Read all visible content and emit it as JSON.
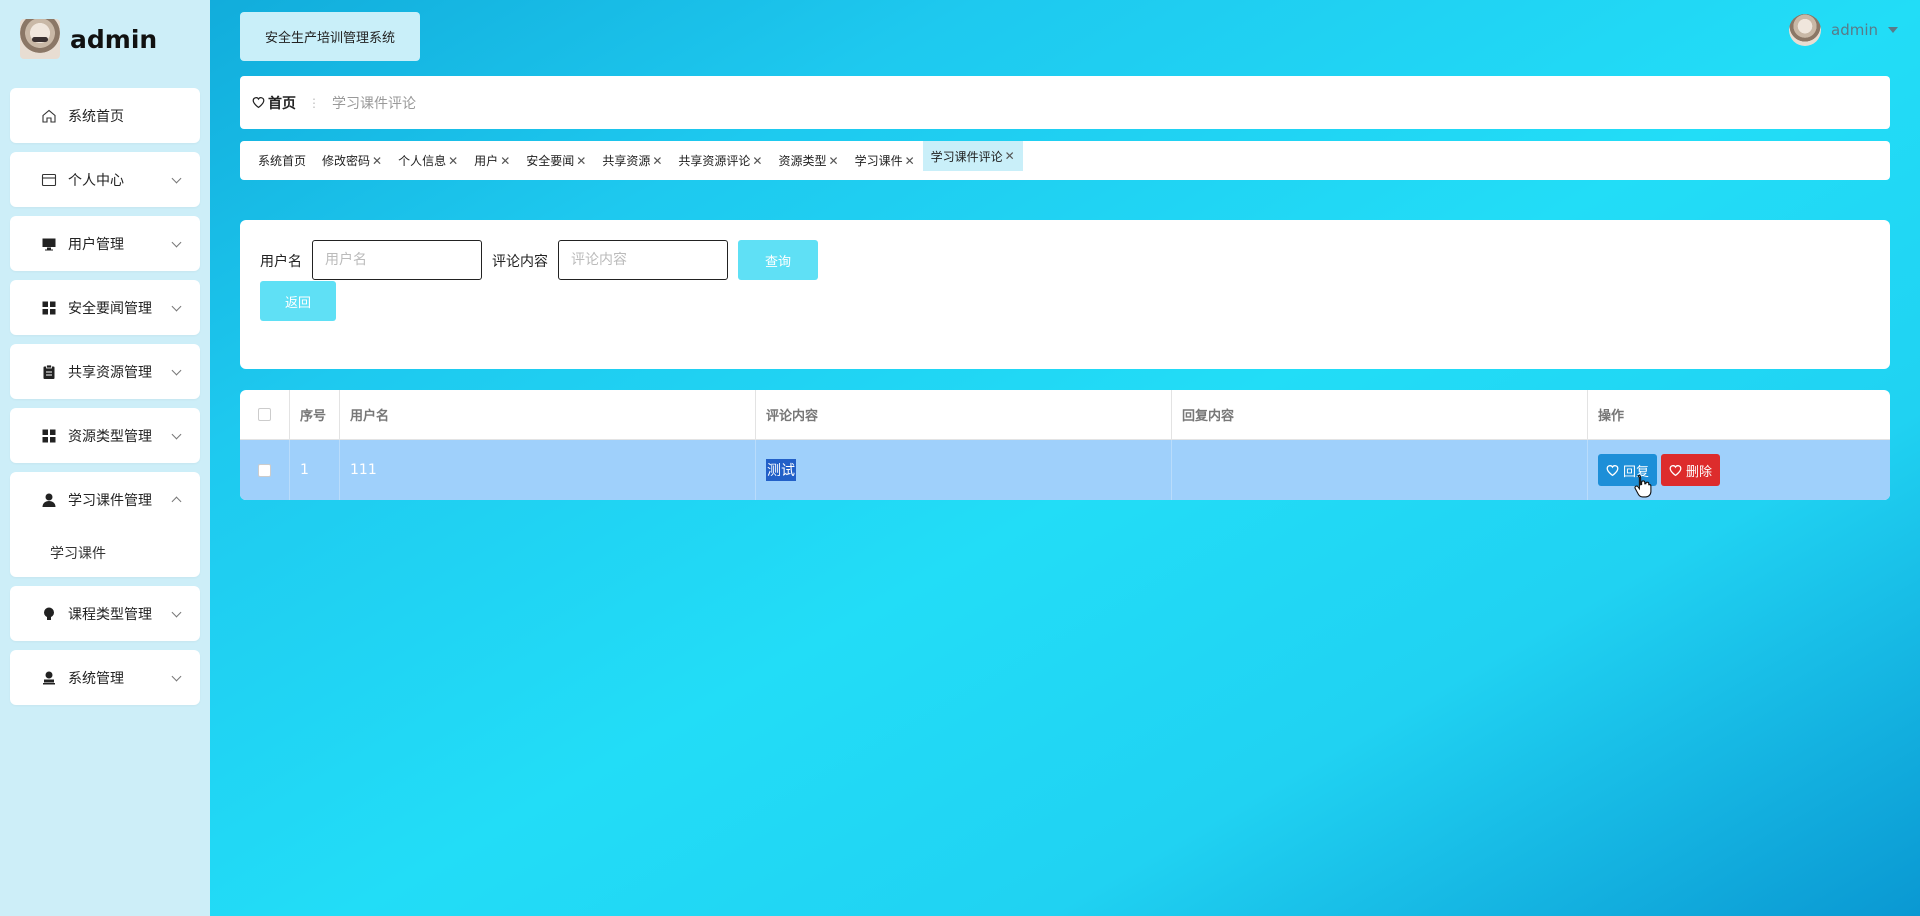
{
  "brand": {
    "name": "admin"
  },
  "sidebar": {
    "items": [
      {
        "label": "系统首页",
        "icon": "home-icon",
        "chevron": false
      },
      {
        "label": "个人中心",
        "icon": "calendar-icon",
        "chevron": true
      },
      {
        "label": "用户管理",
        "icon": "monitor-icon",
        "chevron": true
      },
      {
        "label": "安全要闻管理",
        "icon": "grid-icon",
        "chevron": true
      },
      {
        "label": "共享资源管理",
        "icon": "clipboard-icon",
        "chevron": true
      },
      {
        "label": "资源类型管理",
        "icon": "grid-icon",
        "chevron": true
      },
      {
        "label": "学习课件管理",
        "icon": "user-icon",
        "chevron": true,
        "expanded": true,
        "submenu": [
          "学习课件"
        ]
      },
      {
        "label": "课程类型管理",
        "icon": "bulb-icon",
        "chevron": true
      },
      {
        "label": "系统管理",
        "icon": "stamp-icon",
        "chevron": true
      }
    ]
  },
  "header": {
    "system_title": "安全生产培训管理系统",
    "user_name": "admin"
  },
  "breadcrumb": {
    "home": "首页",
    "current": "学习课件评论"
  },
  "tags": [
    {
      "label": "系统首页",
      "closable": false
    },
    {
      "label": "修改密码",
      "closable": true
    },
    {
      "label": "个人信息",
      "closable": true
    },
    {
      "label": "用户",
      "closable": true
    },
    {
      "label": "安全要闻",
      "closable": true
    },
    {
      "label": "共享资源",
      "closable": true
    },
    {
      "label": "共享资源评论",
      "closable": true
    },
    {
      "label": "资源类型",
      "closable": true
    },
    {
      "label": "学习课件",
      "closable": true
    },
    {
      "label": "学习课件评论",
      "closable": true,
      "active": true
    }
  ],
  "search": {
    "username_label": "用户名",
    "username_placeholder": "用户名",
    "comment_label": "评论内容",
    "comment_placeholder": "评论内容",
    "query_button": "查询",
    "back_button": "返回"
  },
  "table": {
    "columns": [
      "",
      "序号",
      "用户名",
      "评论内容",
      "回复内容",
      "操作"
    ],
    "rows": [
      {
        "index": "1",
        "username": "111",
        "comment": "测试",
        "reply": ""
      }
    ],
    "reply_button": "回复",
    "delete_button": "删除"
  },
  "colors": {
    "sidebar_bg": "#cdeef8",
    "title_bg": "#c9eff9",
    "row_selected": "#9fd0fb",
    "reply_btn": "#1d8fd8",
    "delete_btn": "#dd2c2c",
    "light_btn": "#5fe0f5"
  }
}
